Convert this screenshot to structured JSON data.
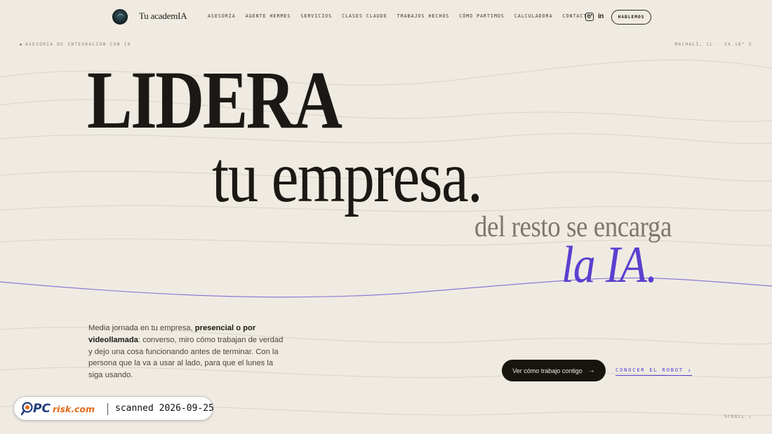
{
  "nav": {
    "brand": "Tu academIA",
    "links": [
      "ASESORÍA",
      "AGENTE HERMES",
      "SERVICIOS",
      "CLASES CLAUDE",
      "TRABAJOS HECHOS",
      "CÓMO PARTIMOS",
      "CALCULADORA",
      "CONTACTO"
    ],
    "social": {
      "linkedin_glyph": "in"
    },
    "cta": "HABLEMOS"
  },
  "eyebrow": "ASESORÍA DE INTEGRACIÓN CON IA",
  "location": "MACHALÍ, CL · 34.18° S",
  "hero": {
    "line1": "LIDERA",
    "line2": "tu empresa.",
    "line3": "del resto se encarga",
    "line4": "la IA."
  },
  "intro": {
    "p1": "Media jornada en tu empresa, ",
    "p1_bold": "presencial o por videollamada",
    "p2": ": converso, miro cómo trabajan de verdad y dejo una cosa funcionando antes de terminar. Con la persona que la va a usar al lado, para que el lunes la siga usando."
  },
  "actions": {
    "primary": "Ver cómo trabajo contigo",
    "primary_icon": "arrow-right-icon",
    "secondary": "CONOCER EL ROBOT ↓"
  },
  "scroll": "SCROLL ↓",
  "watermark": {
    "brand": "PCrisk.com",
    "text": "scanned 2026-09-25"
  },
  "colors": {
    "background": "#efebe2",
    "ink": "#1b1915",
    "accent": "#5a3fcf",
    "muted": "#7d786d"
  }
}
